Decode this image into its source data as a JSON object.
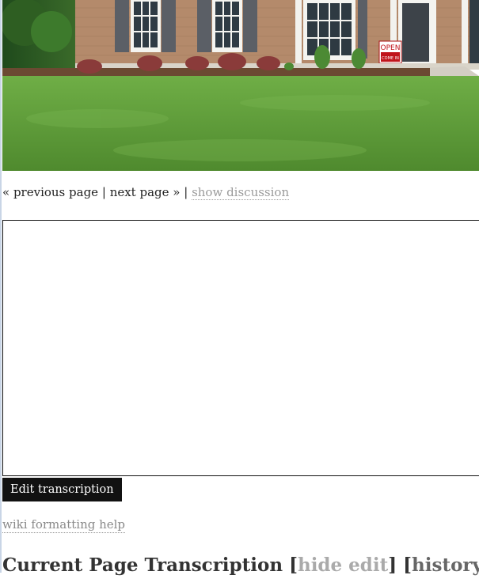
{
  "photo": {
    "sign_text": "OPEN",
    "sign_sub": "COME IN"
  },
  "nav": {
    "previous_label": "« previous page",
    "separator": "|",
    "next_label": "next page »",
    "discussion_label": "show discussion"
  },
  "editor": {
    "value": ""
  },
  "edit_button_label": "Edit transcription",
  "wiki_help_label": "wiki formatting help",
  "heading": {
    "title": "Current Page Transcription",
    "bracket_open": "[",
    "bracket_close": "]",
    "hide_edit_label": "hide edit",
    "history_label": "history"
  },
  "colors": {
    "button_bg": "#111111",
    "muted_link": "#9a9a9a",
    "lawn": "#5e9a3a",
    "brick": "#b58c6e"
  }
}
